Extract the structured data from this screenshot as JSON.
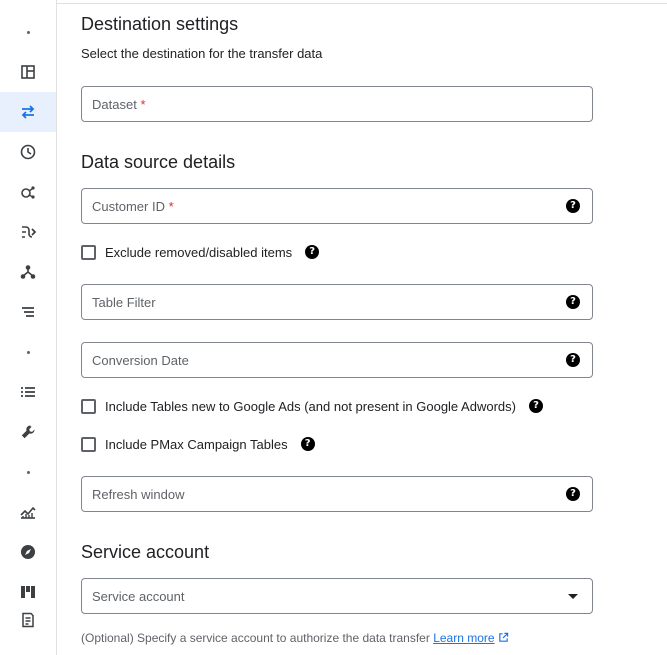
{
  "rail": {
    "items": [
      {
        "icon": "dot-icon"
      },
      {
        "icon": "dashboard-icon"
      },
      {
        "icon": "transfers-icon",
        "active": true
      },
      {
        "icon": "schedule-icon"
      },
      {
        "icon": "analytics-hub-icon"
      },
      {
        "icon": "pipeline-icon"
      },
      {
        "icon": "graph-icon"
      },
      {
        "icon": "list-icon"
      },
      {
        "icon": "dot-icon"
      },
      {
        "icon": "queue-icon"
      },
      {
        "icon": "wrench-icon"
      },
      {
        "icon": "dot-icon"
      },
      {
        "icon": "monitoring-icon"
      },
      {
        "icon": "compass-icon"
      },
      {
        "icon": "grid-icon"
      },
      {
        "icon": "notes-icon"
      }
    ]
  },
  "destination": {
    "title": "Destination settings",
    "description": "Select the destination for the transfer data",
    "dataset_label": "Dataset",
    "required_mark": "*"
  },
  "source": {
    "title": "Data source details",
    "customer_id_label": "Customer ID",
    "exclude_removed_label": "Exclude removed/disabled items",
    "table_filter_label": "Table Filter",
    "conversion_date_label": "Conversion Date",
    "include_new_tables_label": "Include Tables new to Google Ads (and not present in Google Adwords)",
    "include_pmax_label": "Include PMax Campaign Tables",
    "refresh_window_label": "Refresh window"
  },
  "service": {
    "title": "Service account",
    "select_label": "Service account",
    "note": "(Optional) Specify a service account to authorize the data transfer",
    "learn_more": "Learn more"
  },
  "help_glyph": "?"
}
